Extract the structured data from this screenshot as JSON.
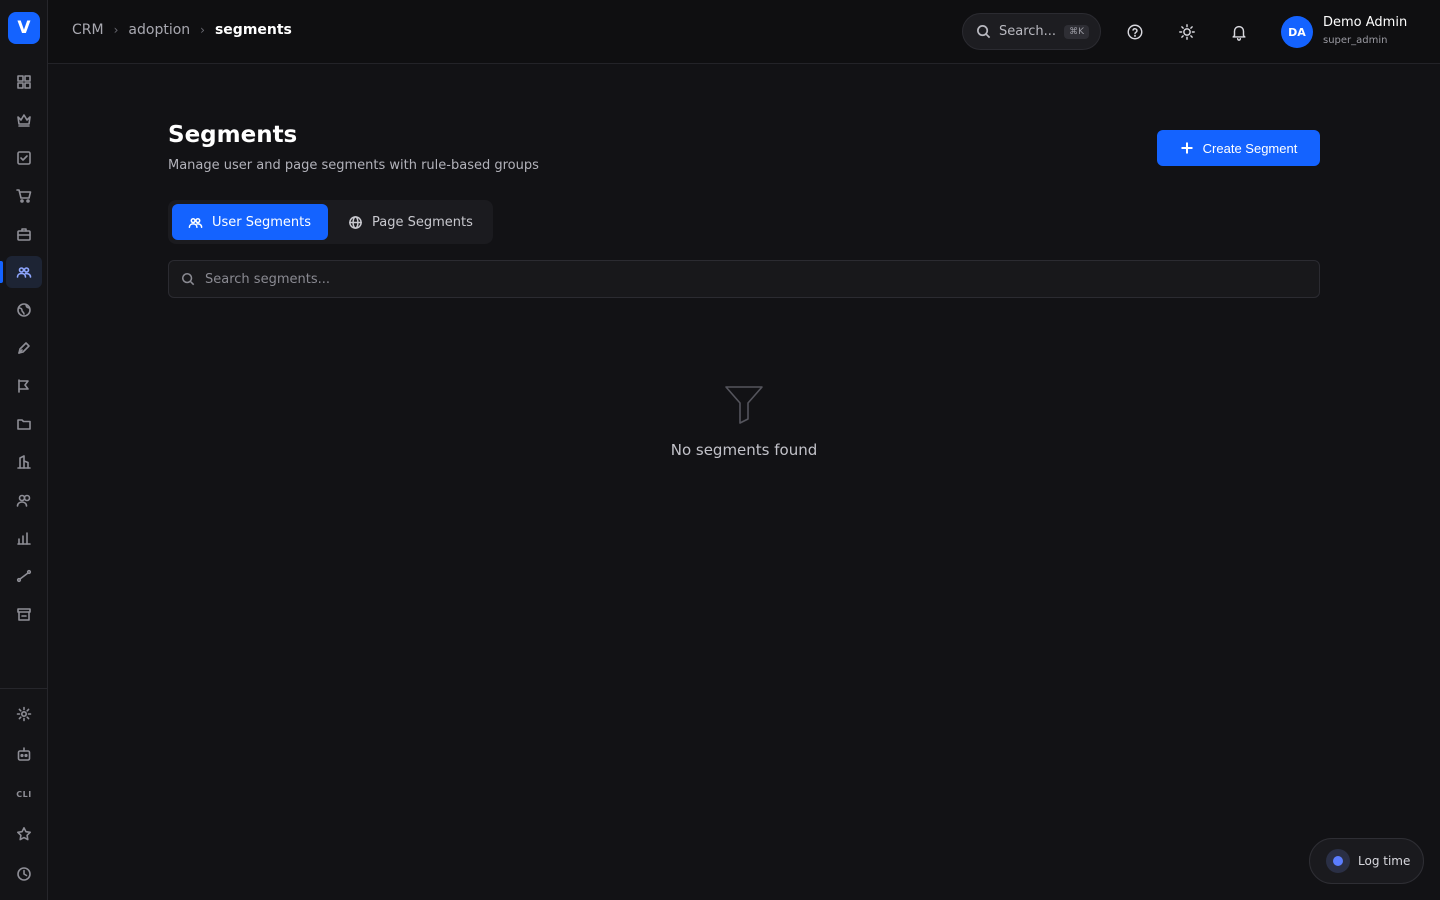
{
  "app": {
    "logo_letter": "V"
  },
  "breadcrumb": [
    "CRM",
    "adoption",
    "segments"
  ],
  "header": {
    "search_label": "Search...",
    "search_shortcut": "⌘K",
    "user": {
      "initials": "DA",
      "name": "Demo Admin",
      "role": "super_admin"
    }
  },
  "sidebar": {
    "items": [
      {
        "name": "grid-icon"
      },
      {
        "name": "crown-icon"
      },
      {
        "name": "checkbox-icon"
      },
      {
        "name": "cart-icon"
      },
      {
        "name": "briefcase-icon"
      },
      {
        "name": "users-icon",
        "active": true
      },
      {
        "name": "globe-icon"
      },
      {
        "name": "pen-icon"
      },
      {
        "name": "campaign-icon"
      },
      {
        "name": "folder-icon"
      },
      {
        "name": "building-icon"
      },
      {
        "name": "people-icon"
      },
      {
        "name": "bar-chart-icon"
      },
      {
        "name": "route-icon"
      },
      {
        "name": "store-icon"
      }
    ],
    "bottom": {
      "cli_label": "CLI"
    }
  },
  "page": {
    "title": "Segments",
    "subtitle": "Manage user and page segments with rule-based groups",
    "create_button": "Create Segment"
  },
  "tabs": [
    {
      "label": "User Segments",
      "active": true
    },
    {
      "label": "Page Segments",
      "active": false
    }
  ],
  "search": {
    "placeholder": "Search segments..."
  },
  "empty_state": {
    "message": "No segments found"
  },
  "floating": {
    "log_time": "Log time"
  },
  "colors": {
    "accent": "#1463ff",
    "background": "#121215"
  }
}
